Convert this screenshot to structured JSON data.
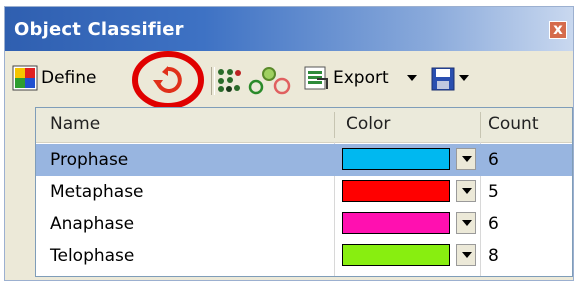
{
  "window": {
    "title": "Object Classifier",
    "close_glyph": "x"
  },
  "toolbar": {
    "define_label": "Define",
    "export_label": "Export",
    "icons": [
      "define-icon",
      "refresh-icon",
      "dots-icon",
      "circles-icon",
      "export-icon",
      "save-icon"
    ],
    "highlight_color": "#e00000"
  },
  "table": {
    "columns": [
      "Name",
      "Color",
      "Count"
    ],
    "rows": [
      {
        "name": "Prophase",
        "color": "#00b8f0",
        "count": "6"
      },
      {
        "name": "Metaphase",
        "color": "#ff0000",
        "count": "5"
      },
      {
        "name": "Anaphase",
        "color": "#ff10b0",
        "count": "6"
      },
      {
        "name": "Telophase",
        "color": "#88ee10",
        "count": "8"
      }
    ],
    "selected_row": 0
  }
}
